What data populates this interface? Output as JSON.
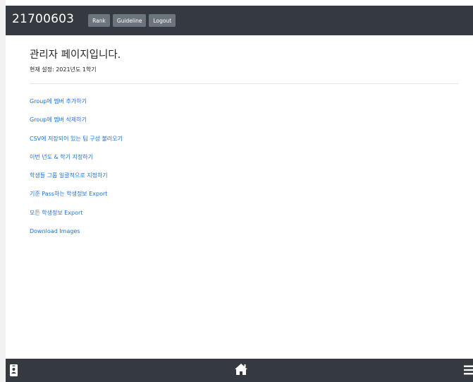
{
  "header": {
    "brand": "21700603",
    "buttons": [
      {
        "label": "Rank"
      },
      {
        "label": "Guideline"
      },
      {
        "label": "Logout"
      }
    ]
  },
  "main": {
    "title": "관리자 페이지입니다.",
    "subtitle": "현재 설정: 2021년도 1학기",
    "links": [
      {
        "label": "Group에 멤버 추가하기"
      },
      {
        "label": "Group에 멤버 삭제하기"
      },
      {
        "label": "CSV에 저장되어 있는 팀 구성 불러오기"
      },
      {
        "label": "이번 년도 & 학기 지정하기"
      },
      {
        "label": "학생들 그룹 일괄적으로 지정하기"
      },
      {
        "label": "기준 Pass하는 학생정보 Export"
      },
      {
        "label": "모든 학생정보 Export"
      },
      {
        "label": "Download Images"
      }
    ]
  },
  "footer": {
    "icons": [
      "id-badge-icon",
      "home-icon",
      "menu-icon"
    ]
  },
  "colors": {
    "navbar": "#343a40",
    "button": "#6c757d",
    "link": "#1a73e8"
  }
}
